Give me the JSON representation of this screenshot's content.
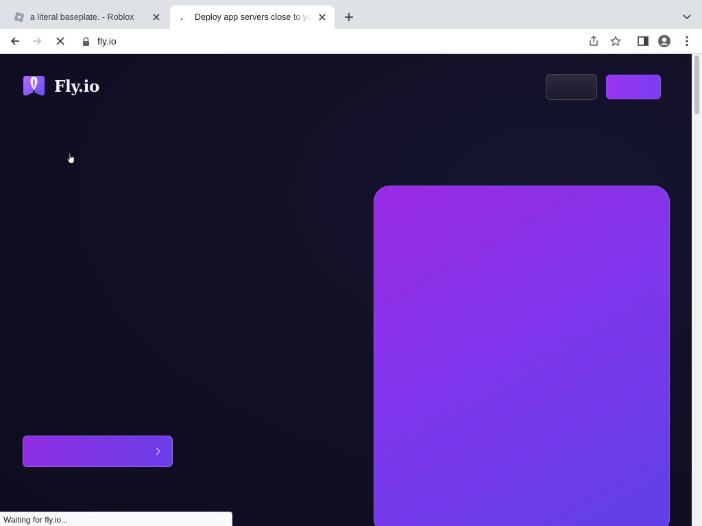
{
  "browser": {
    "tabs": [
      {
        "title": "a literal baseplate. - Roblox",
        "favicon": "roblox-icon",
        "active": false
      },
      {
        "title": "Deploy app servers close to your users",
        "favicon": "loading-spinner-icon",
        "active": true
      }
    ],
    "address": {
      "url": "fly.io",
      "secure": true
    },
    "status_text": "Waiting for fly.io..."
  },
  "page": {
    "logo_text": "Fly.io",
    "theme": {
      "background": "#110f24",
      "accent_start": "#9b34f0",
      "accent_end": "#5f40e6"
    }
  }
}
